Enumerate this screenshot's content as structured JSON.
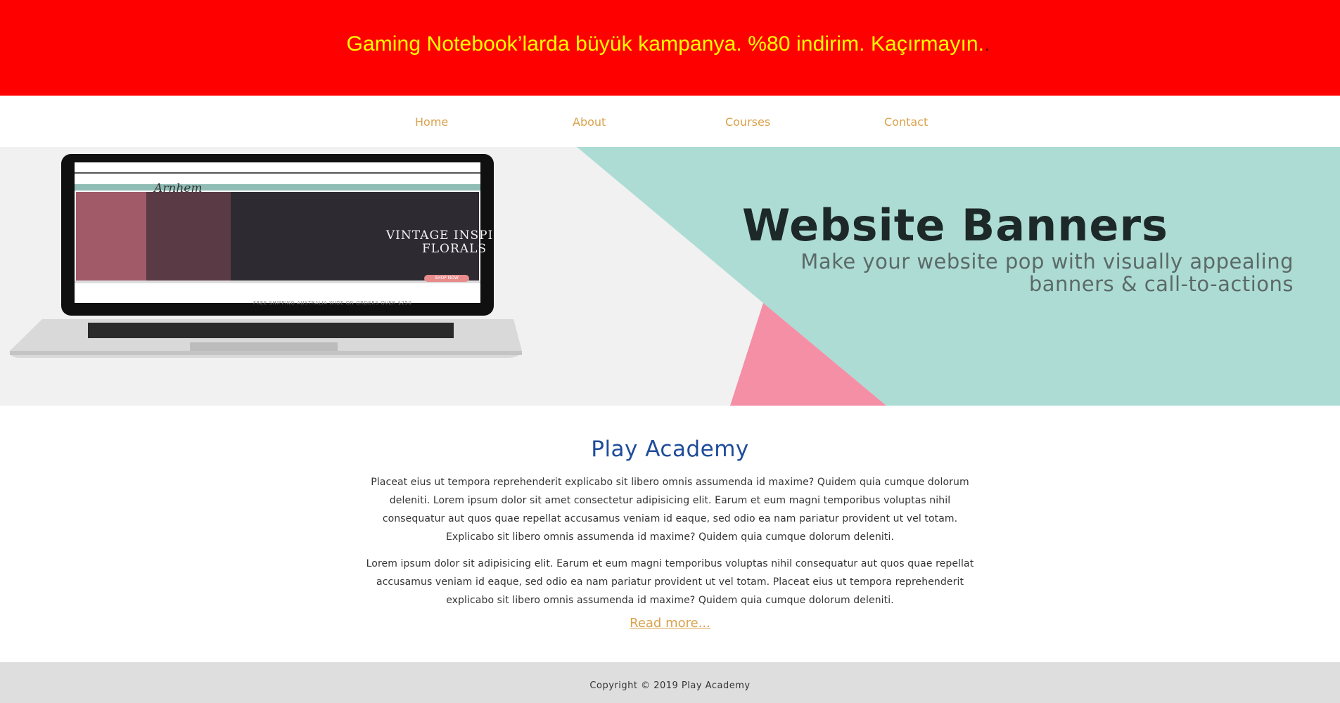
{
  "promo": {
    "text": "Gaming Notebook’larda büyük kampanya. %80 indirim. Kaçırmayın.",
    "trailing": ".",
    "background": "#ff0000",
    "text_color": "#ffff00"
  },
  "nav": {
    "items": [
      {
        "label": "Home"
      },
      {
        "label": "About"
      },
      {
        "label": "Courses"
      },
      {
        "label": "Contact"
      }
    ],
    "link_color": "#d9a24c"
  },
  "banner": {
    "title": "Website Banners",
    "subtitle": "Make your website pop with visually appealing banners & call-to-actions",
    "screen_logo": "Arnhem",
    "screen_headline": "VINTAGE INSPIRED FLORALS",
    "screen_button": "SHOP NOW",
    "screen_shipping": "FREE SHIPPING AUSTRALIA WIDE ON ORDERS OVER $250",
    "colors": {
      "teal": "#addcd4",
      "pink": "#f48fa6",
      "grey": "#f1f1f1"
    }
  },
  "main": {
    "title": "Play Academy",
    "paragraph1": "Placeat eius ut tempora reprehenderit explicabo sit libero omnis assumenda id maxime? Quidem quia cumque dolorum deleniti. Lorem ipsum dolor sit amet consectetur adipisicing elit. Earum et eum magni temporibus voluptas nihil consequatur aut quos quae repellat accusamus veniam id eaque, sed odio ea nam pariatur provident ut vel totam. Explicabo sit libero omnis assumenda id maxime? Quidem quia cumque dolorum deleniti.",
    "paragraph2": "Lorem ipsum dolor sit adipisicing elit. Earum et eum magni temporibus voluptas nihil consequatur aut quos quae repellat accusamus veniam id eaque, sed odio ea nam pariatur provident ut vel totam. Placeat eius ut tempora reprehenderit explicabo sit libero omnis assumenda id maxime? Quidem quia cumque dolorum deleniti.",
    "read_more": "Read more...",
    "title_color": "#1f4c9a"
  },
  "footer": {
    "copyright": "Copyright © 2019 Play Academy"
  }
}
